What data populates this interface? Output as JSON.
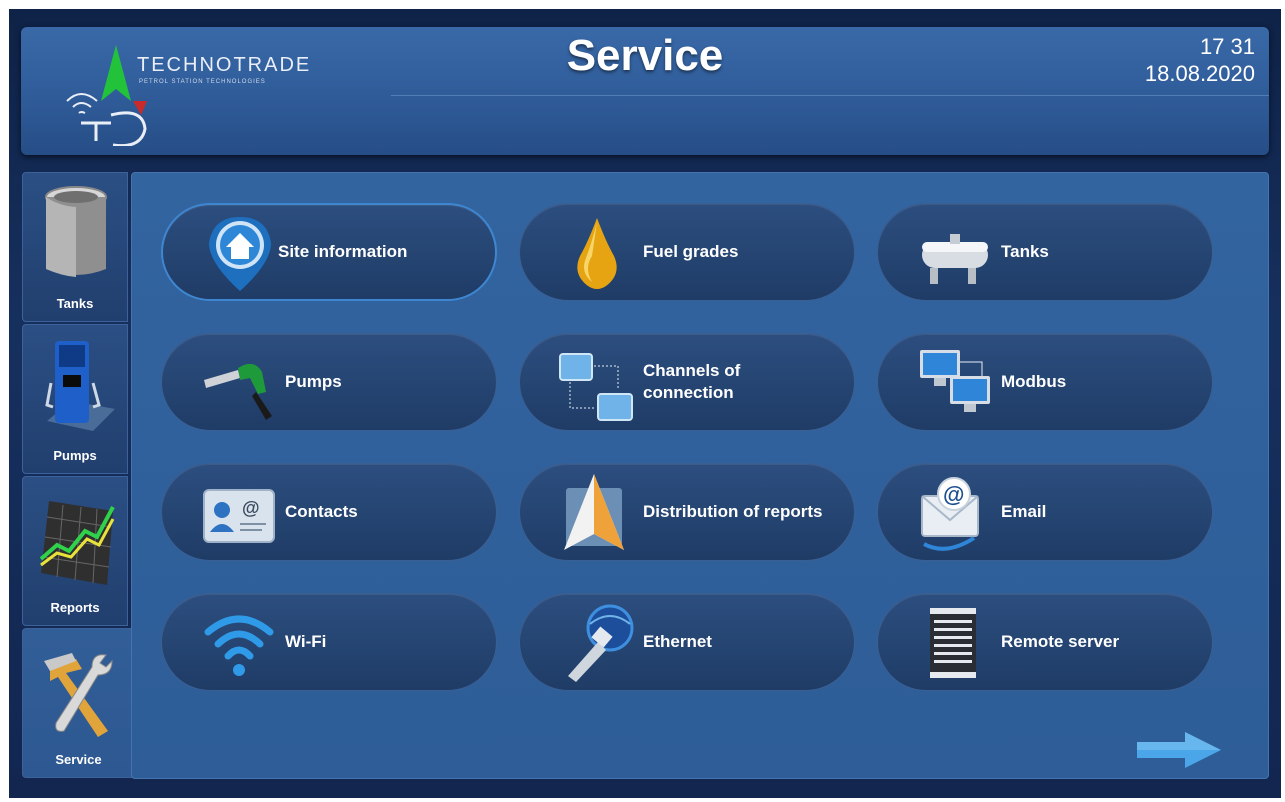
{
  "header": {
    "brand": "TECHNOTRADE",
    "brand_tagline": "PETROL STATION TECHNOLOGIES",
    "title": "Service",
    "time": "17 31",
    "date": "18.08.2020"
  },
  "sidebar": {
    "items": [
      {
        "label": "Tanks",
        "icon": "tank-icon"
      },
      {
        "label": "Pumps",
        "icon": "fuel-pump-icon"
      },
      {
        "label": "Reports",
        "icon": "chart-icon"
      },
      {
        "label": "Service",
        "icon": "tools-icon",
        "active": true
      }
    ]
  },
  "menu": {
    "items": [
      {
        "label": "Site information",
        "icon": "home-pin-icon"
      },
      {
        "label": "Fuel grades",
        "icon": "oil-drop-icon"
      },
      {
        "label": "Tanks",
        "icon": "tank-icon"
      },
      {
        "label": "Pumps",
        "icon": "fuel-nozzle-icon"
      },
      {
        "label": "Channels of connection",
        "icon": "connection-icon"
      },
      {
        "label": "Modbus",
        "icon": "computers-icon"
      },
      {
        "label": "Contacts",
        "icon": "contact-card-icon"
      },
      {
        "label": "Distribution of reports",
        "icon": "send-icon"
      },
      {
        "label": "Email",
        "icon": "email-icon"
      },
      {
        "label": "Wi-Fi",
        "icon": "wifi-icon"
      },
      {
        "label": "Ethernet",
        "icon": "ethernet-icon"
      },
      {
        "label": "Remote server",
        "icon": "server-icon"
      }
    ]
  },
  "colors": {
    "accent": "#3f86d1",
    "panel": "#2e5d97",
    "arrow": "#4aa6e8"
  }
}
